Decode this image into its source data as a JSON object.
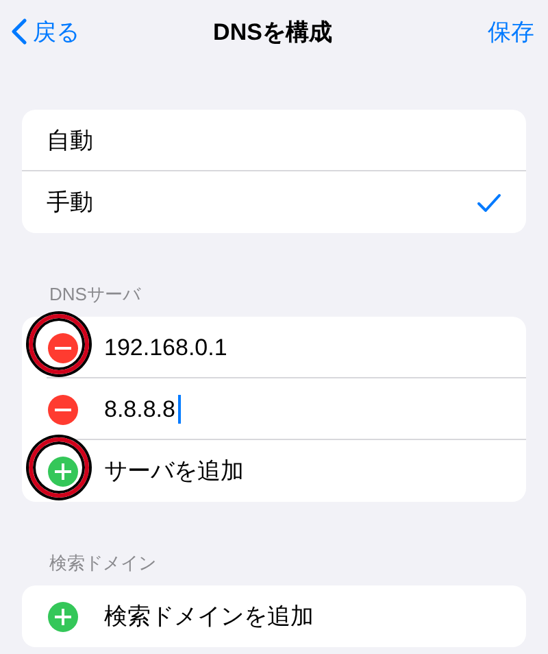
{
  "nav": {
    "back": "戻る",
    "title": "DNSを構成",
    "action": "保存"
  },
  "mode_options": [
    {
      "label": "自動",
      "selected": false
    },
    {
      "label": "手動",
      "selected": true
    }
  ],
  "dns_section": {
    "header": "DNSサーバ",
    "servers": [
      {
        "address": "192.168.0.1",
        "focused": false,
        "annotated": true
      },
      {
        "address": "8.8.8.8",
        "focused": true,
        "annotated": false
      }
    ],
    "add": {
      "label": "サーバを追加",
      "annotated": true
    }
  },
  "search_section": {
    "header": "検索ドメイン",
    "add": {
      "label": "検索ドメインを追加",
      "annotated": false
    }
  }
}
